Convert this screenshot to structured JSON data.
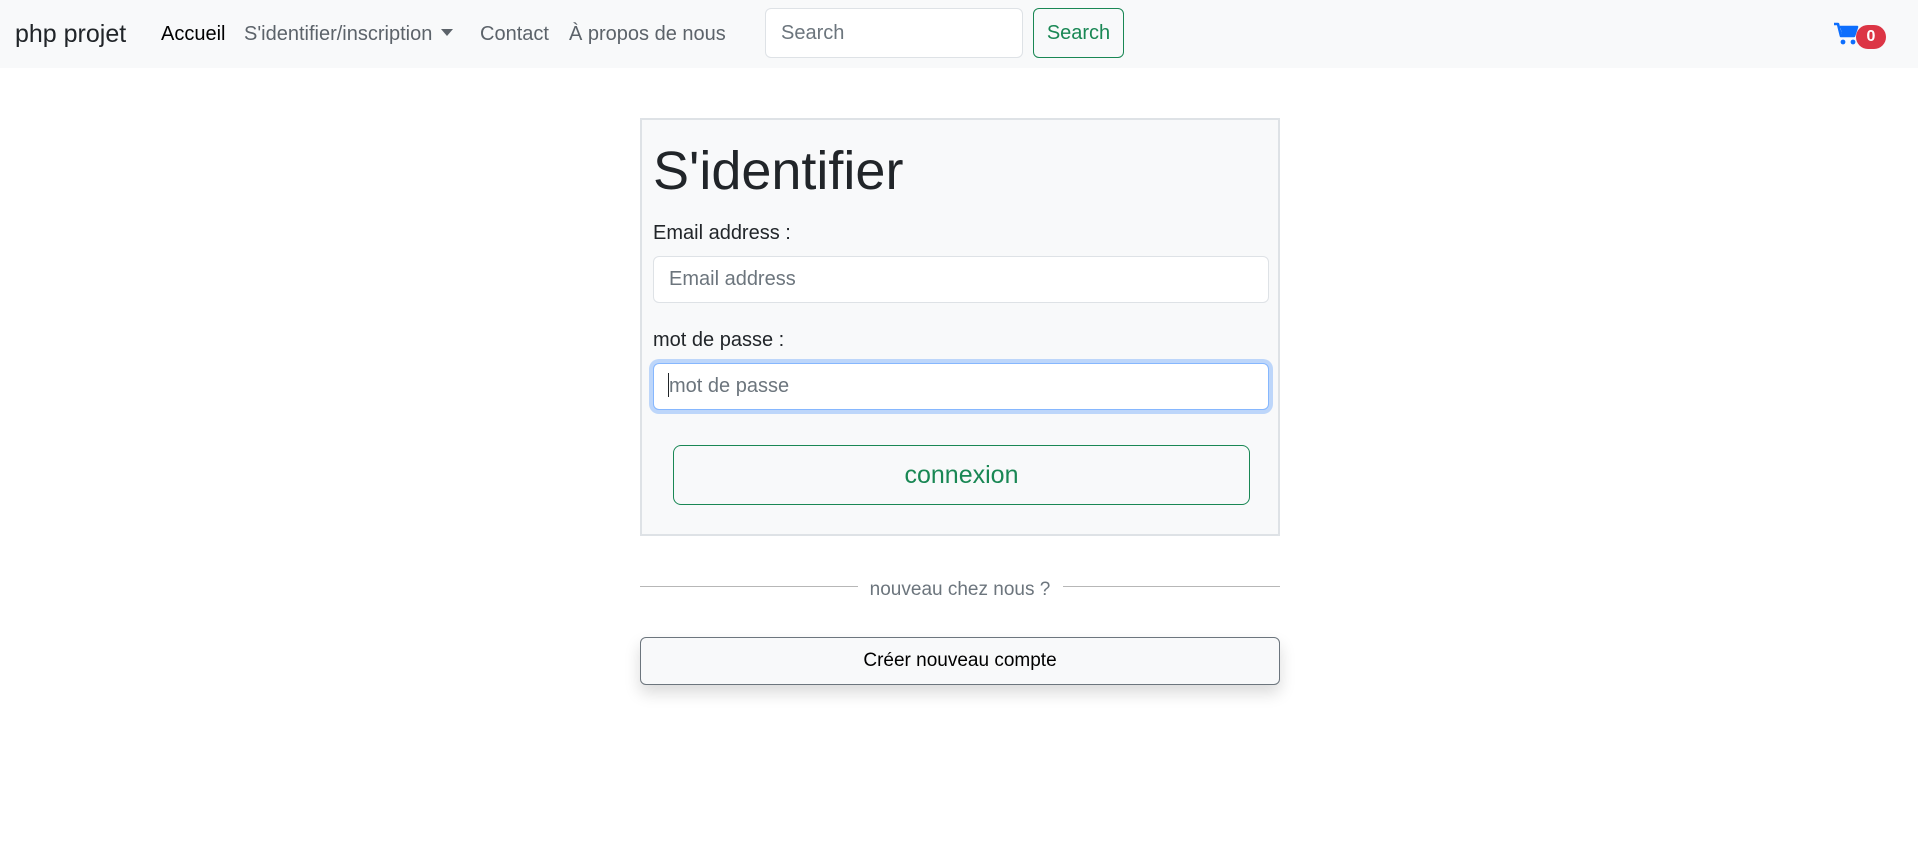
{
  "navbar": {
    "brand": "php projet",
    "links": {
      "home": "Accueil",
      "auth": "S'identifier/inscription",
      "contact": "Contact",
      "about": "À propos de nous"
    },
    "search": {
      "placeholder": "Search",
      "value": "",
      "button_label": "Search"
    },
    "cart": {
      "icon": "cart-icon",
      "count": "0",
      "icon_color": "#0d6efd",
      "badge_color": "#dc3545"
    }
  },
  "login": {
    "title": "S'identifier",
    "email": {
      "label": "Email address :",
      "placeholder": "Email address",
      "value": ""
    },
    "password": {
      "label": "mot de passe :",
      "placeholder": "mot de passe",
      "value": ""
    },
    "submit_label": "connexion",
    "accent_color": "#198754"
  },
  "signup": {
    "divider_text": "nouveau chez nous ?",
    "create_label": "Créer nouveau compte"
  }
}
